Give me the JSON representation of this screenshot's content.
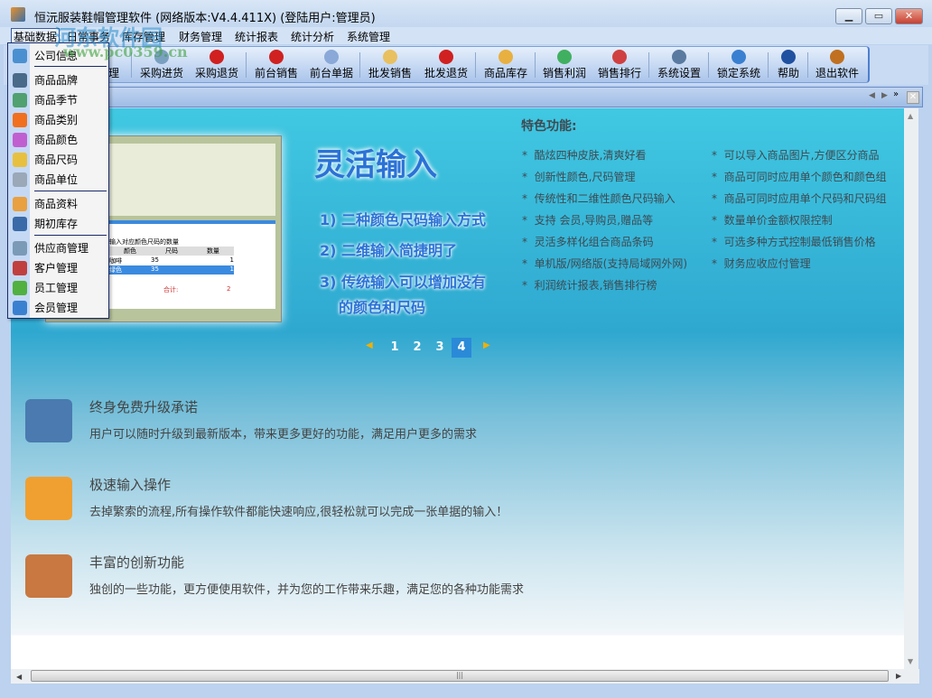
{
  "window": {
    "title": "恒沅服装鞋帽管理软件 (网络版本:V4.4.411X) (登陆用户:管理员)",
    "controls": [
      "minimize",
      "maximize",
      "close"
    ]
  },
  "watermark": {
    "text1": "河东软件园",
    "text2": "www.pc0359.cn"
  },
  "menubar": {
    "items": [
      "基础数据",
      "日常事务",
      "库存管理",
      "财务管理",
      "统计报表",
      "统计分析",
      "系统管理"
    ]
  },
  "toolbar": {
    "partial_label": "管理",
    "buttons": [
      {
        "label": "采购进货",
        "icon": "truck-icon",
        "color": "#7aa0c0"
      },
      {
        "label": "采购退货",
        "icon": "return-icon",
        "color": "#d02020"
      },
      {
        "label": "前台销售",
        "icon": "basket-icon",
        "color": "#d02020"
      },
      {
        "label": "前台单据",
        "icon": "documents-icon",
        "color": "#8aa8d8"
      },
      {
        "label": "批发销售",
        "icon": "wholesale-icon",
        "color": "#e8c060"
      },
      {
        "label": "批发退货",
        "icon": "wholesale-return-icon",
        "color": "#d02020"
      },
      {
        "label": "商品库存",
        "icon": "boxes-icon",
        "color": "#e8b040"
      },
      {
        "label": "销售利润",
        "icon": "pie-chart-icon",
        "color": "#40b060"
      },
      {
        "label": "销售排行",
        "icon": "bar-chart-icon",
        "color": "#d04040"
      },
      {
        "label": "系统设置",
        "icon": "settings-icon",
        "color": "#5a7aa0"
      },
      {
        "label": "锁定系统",
        "icon": "lock-icon",
        "color": "#3a80d0"
      },
      {
        "label": "帮助",
        "icon": "help-icon",
        "color": "#2050a0"
      },
      {
        "label": "退出软件",
        "icon": "exit-door-icon",
        "color": "#c07020"
      }
    ]
  },
  "dropdown": {
    "items": [
      {
        "label": "公司信息",
        "icon": "company-icon",
        "color": "#4a90d0"
      },
      {
        "label": "商品品牌",
        "icon": "brand-icon",
        "color": "#4a6a8a"
      },
      {
        "label": "商品季节",
        "icon": "season-icon",
        "color": "#50a070"
      },
      {
        "label": "商品类别",
        "icon": "category-icon",
        "color": "#f07020"
      },
      {
        "label": "商品颜色",
        "icon": "color-wheel-icon",
        "color": "#c060d0"
      },
      {
        "label": "商品尺码",
        "icon": "ruler-icon",
        "color": "#e8c040"
      },
      {
        "label": "商品单位",
        "icon": "unit-icon",
        "color": "#9aa8b8"
      },
      {
        "label": "商品资料",
        "icon": "product-icon",
        "color": "#e8a040"
      },
      {
        "label": "期初库存",
        "icon": "stock-icon",
        "color": "#3a6aa8"
      },
      {
        "label": "供应商管理",
        "icon": "supplier-icon",
        "color": "#7a9ab8"
      },
      {
        "label": "客户管理",
        "icon": "customer-icon",
        "color": "#c04040"
      },
      {
        "label": "员工管理",
        "icon": "employee-icon",
        "color": "#50b040"
      },
      {
        "label": "会员管理",
        "icon": "member-card-icon",
        "color": "#3a80d0"
      }
    ]
  },
  "banner": {
    "heading": "灵活输入",
    "points": [
      "1) 二种颜色尺码输入方式",
      "2) 二维输入简捷明了",
      "3) 传统输入可以增加没有",
      "的颜色和尺码"
    ],
    "pager": {
      "pages": [
        "1",
        "2",
        "3",
        "4"
      ],
      "current": "4",
      "accent": "#2a8ad8"
    },
    "features_title": "特色功能:",
    "features_left": [
      "酷炫四种皮肤,清爽好看",
      "创新性颜色,尺码管理",
      "传统性和二维性颜色尺码输入",
      "支持  会员,导购员,赠品等",
      "灵活多样化组合商品条码",
      "单机版/网络版(支持局域网外网)",
      "利润统计报表,销售排行榜"
    ],
    "features_right": [
      "可以导入商品图片,方便区分商品",
      "商品可同时应用单个颜色和颜色组",
      "商品可同时应用单个尺码和尺码组",
      "数量单价金额权限控制",
      "可选多种方式控制最低销售价格",
      "财务应收应付管理"
    ],
    "thumb": {
      "headers": [
        "颜色",
        "尺码",
        "数量"
      ],
      "rows": [
        [
          "咖啡",
          "35",
          "1"
        ],
        [
          "绿色",
          "35",
          "1"
        ]
      ],
      "total_label": "合计:",
      "total": "2",
      "group_label": "输入对应颜色尺码的数量"
    }
  },
  "sections": [
    {
      "title": "终身免费升级承诺",
      "desc": "用户可以随时升级到最新版本，带来更多更好的功能，满足用户更多的需求",
      "icon": "monitor-magnifier-icon"
    },
    {
      "title": "极速输入操作",
      "desc": "去掉繁索的流程,所有操作软件都能快速响应,很轻松就可以完成一张单据的输入！",
      "icon": "pyramid-icon"
    },
    {
      "title": "丰富的创新功能",
      "desc": "独创的一些功能，更方便使用软件，并为您的工作带来乐趣，满足您的各种功能需求",
      "icon": "toolbox-add-icon"
    }
  ]
}
